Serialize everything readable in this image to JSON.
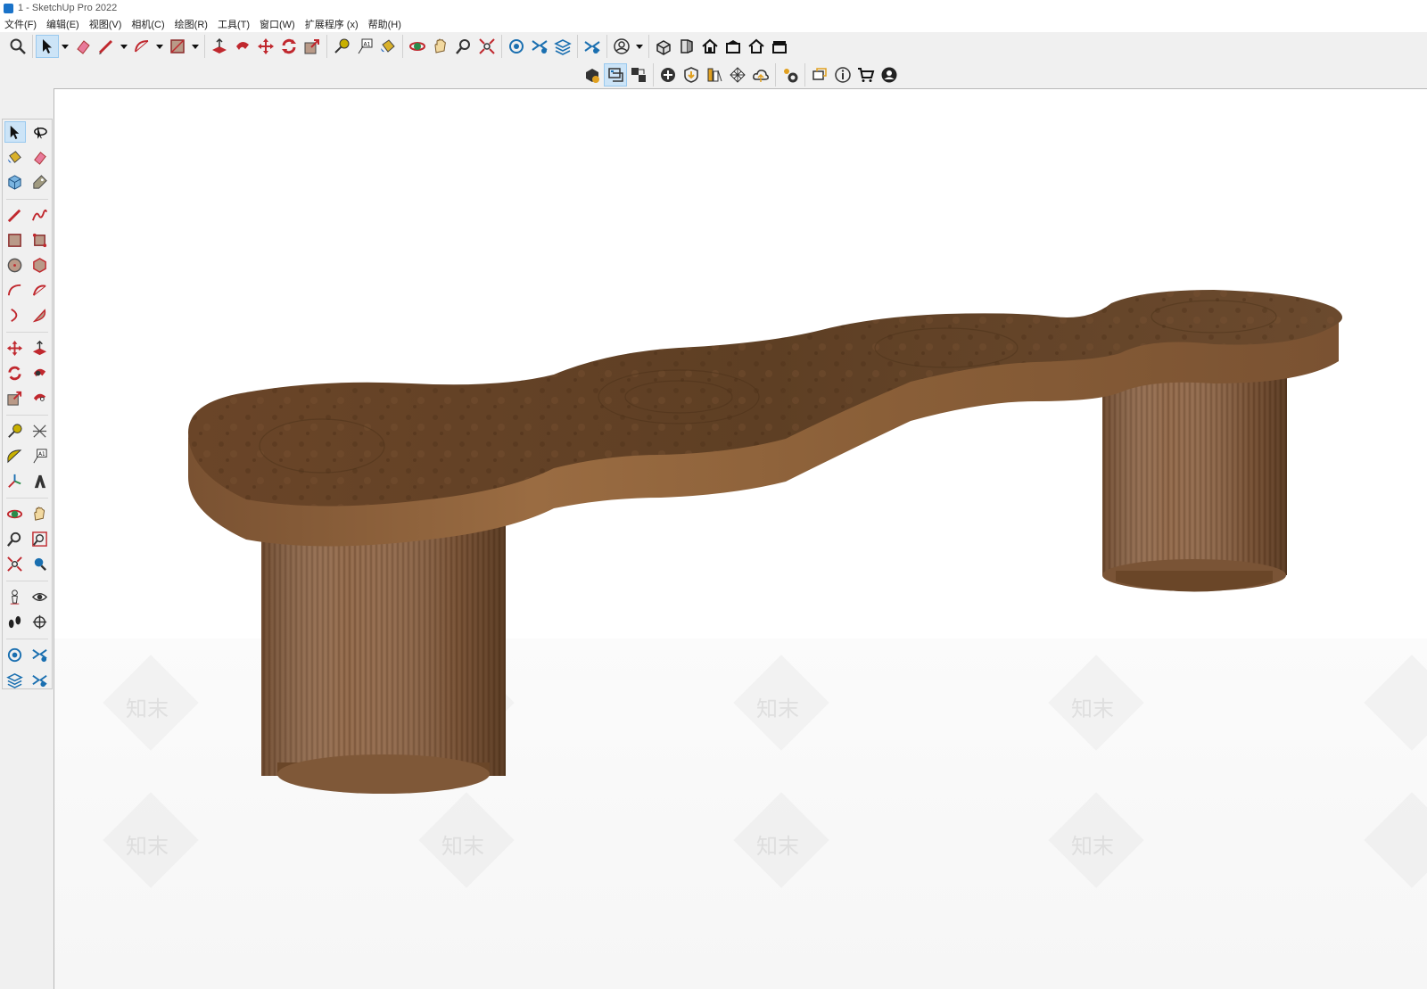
{
  "window": {
    "title": "1 - SketchUp Pro 2022"
  },
  "menu": [
    "文件(F)",
    "编辑(E)",
    "视图(V)",
    "相机(C)",
    "绘图(R)",
    "工具(T)",
    "窗口(W)",
    "扩展程序 (x)",
    "帮助(H)"
  ],
  "watermark": {
    "text": "知末"
  },
  "colors": {
    "wood_top": "#6e4a2c",
    "wood_edge": "#8a5f38",
    "leg_wood": "#875f3f",
    "selection": "#cce4f7"
  },
  "toolbar1_icons": [
    "zoom-icon",
    "select-icon",
    "eraser-icon",
    "pencil-icon",
    "arc-icon",
    "rectangle-icon",
    "push-pull-icon",
    "follow-me-icon",
    "move-icon",
    "rotate-icon",
    "scale-icon",
    "tape-measure-icon",
    "text-icon",
    "paint-bucket-icon",
    "orbit-icon",
    "pan-icon",
    "zoom-window-icon",
    "zoom-extents-icon",
    "warehouse-icon",
    "extension-icon",
    "layers-icon",
    "components-icon",
    "account-icon",
    "iso-view-icon",
    "front-view-icon",
    "home-view-icon",
    "top-view-icon",
    "right-view-icon",
    "back-view-icon"
  ],
  "toolbar2_icons": [
    "solid-tools-icon",
    "section-plane-icon",
    "section-display-icon",
    "add-location-icon",
    "shadow-icon",
    "styles-icon",
    "texture-icon",
    "cloud-icon",
    "settings-icon",
    "comment-icon",
    "info-icon",
    "cart-icon",
    "user-icon"
  ]
}
